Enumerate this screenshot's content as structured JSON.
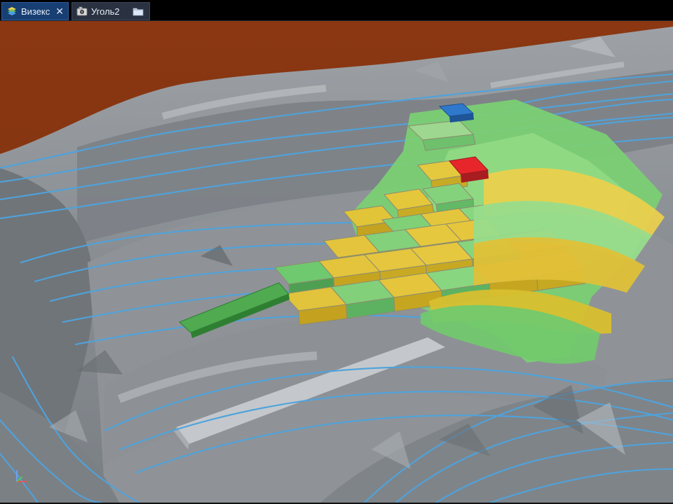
{
  "tabs": [
    {
      "label": "Визекс",
      "active": true,
      "icon": "layers-icon",
      "closable": true
    },
    {
      "label": "Уголь2",
      "active": false,
      "icon": "camera-icon",
      "closable": false
    }
  ],
  "toolbar": {
    "open_icon": "folder-icon"
  },
  "scene": {
    "icon": "axis-gizmo-icon",
    "colors": {
      "background": "#8a3712",
      "terrain": "#8d9297",
      "terrain_light": "#b7bcc1",
      "terrain_dark": "#6f7479",
      "contour": "#4ea3dc",
      "block_green": "#63bd6a",
      "block_green_light": "#95d58f",
      "block_yellow": "#e2c53a",
      "block_red": "#d9262b",
      "block_blue": "#2f75c7"
    }
  }
}
